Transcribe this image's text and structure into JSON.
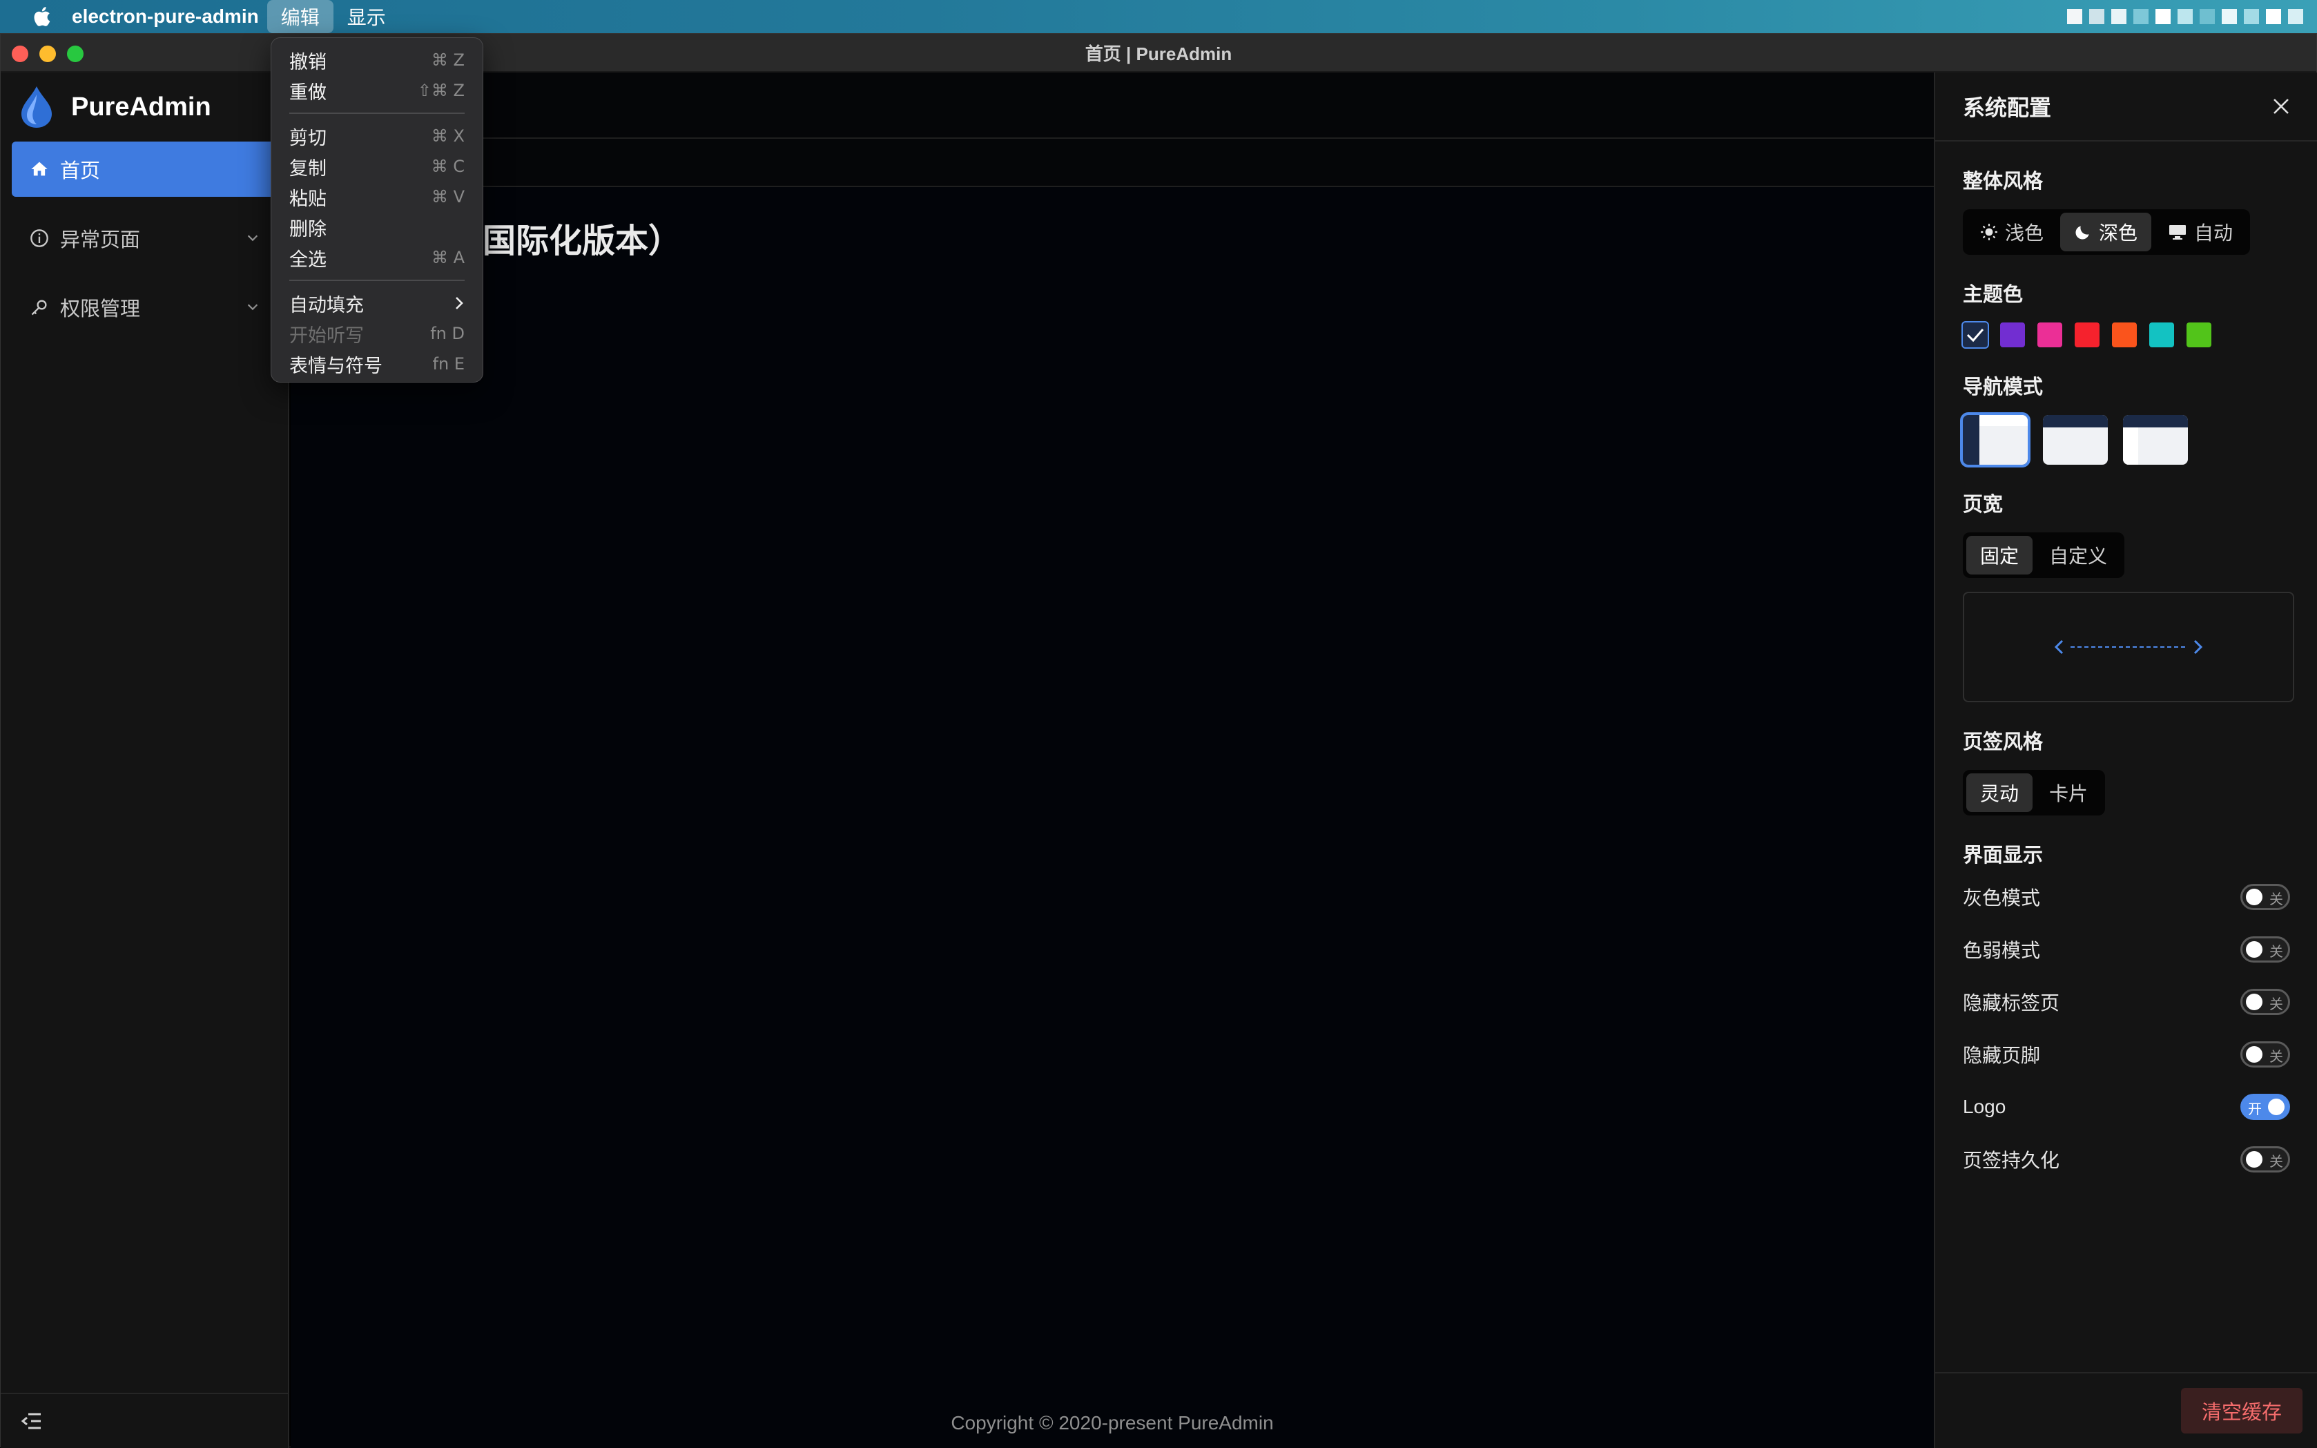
{
  "menubar": {
    "app_name": "electron-pure-admin",
    "menus": [
      "编辑",
      "显示"
    ]
  },
  "window": {
    "title": "首页 | PureAdmin"
  },
  "sidebar": {
    "logo_text": "PureAdmin",
    "items": [
      {
        "label": "首页",
        "icon": "home-icon",
        "active": true
      },
      {
        "label": "异常页面",
        "icon": "info-circle-icon",
        "expandable": true
      },
      {
        "label": "权限管理",
        "icon": "key-icon",
        "expandable": true
      }
    ]
  },
  "edit_menu": {
    "items": [
      {
        "label": "撤销",
        "shortcut": "⌘ Z"
      },
      {
        "label": "重做",
        "shortcut": "⇧⌘ Z"
      },
      {
        "label": "剪切",
        "shortcut": "⌘ X"
      },
      {
        "label": "复制",
        "shortcut": "⌘ C"
      },
      {
        "label": "粘贴",
        "shortcut": "⌘ V"
      },
      {
        "label": "删除",
        "shortcut": ""
      },
      {
        "label": "全选",
        "shortcut": "⌘ A"
      },
      {
        "label": "自动填充",
        "shortcut": ""
      },
      {
        "label": "开始听写",
        "shortcut": "fn D",
        "disabled": true
      },
      {
        "label": "表情与符号",
        "shortcut": "fn E"
      }
    ]
  },
  "main": {
    "welcome_title": "in-Thin（非国际化版本）",
    "footer": "Copyright © 2020-present PureAdmin"
  },
  "settings": {
    "title": "系统配置",
    "theme_style": {
      "title": "整体风格",
      "options": [
        "浅色",
        "深色",
        "自动"
      ],
      "selected": "深色"
    },
    "theme_color": {
      "title": "主题色",
      "colors": [
        "#1b2a47",
        "#722ed1",
        "#eb2f96",
        "#f5222d",
        "#fa541c",
        "#13c2c2",
        "#52c41a"
      ],
      "selected_index": 0
    },
    "nav_mode": {
      "title": "导航模式",
      "selected_index": 0
    },
    "page_width": {
      "title": "页宽",
      "options": [
        "固定",
        "自定义"
      ],
      "selected": "固定"
    },
    "tag_style": {
      "title": "页签风格",
      "options": [
        "灵动",
        "卡片"
      ],
      "selected": "灵动"
    },
    "display": {
      "title": "界面显示",
      "toggles": [
        {
          "label": "灰色模式",
          "state": "关",
          "on": false
        },
        {
          "label": "色弱模式",
          "state": "关",
          "on": false
        },
        {
          "label": "隐藏标签页",
          "state": "关",
          "on": false
        },
        {
          "label": "隐藏页脚",
          "state": "关",
          "on": false
        },
        {
          "label": "Logo",
          "state": "开",
          "on": true
        },
        {
          "label": "页签持久化",
          "state": "关",
          "on": false
        }
      ]
    },
    "clear_cache": "清空缓存"
  }
}
